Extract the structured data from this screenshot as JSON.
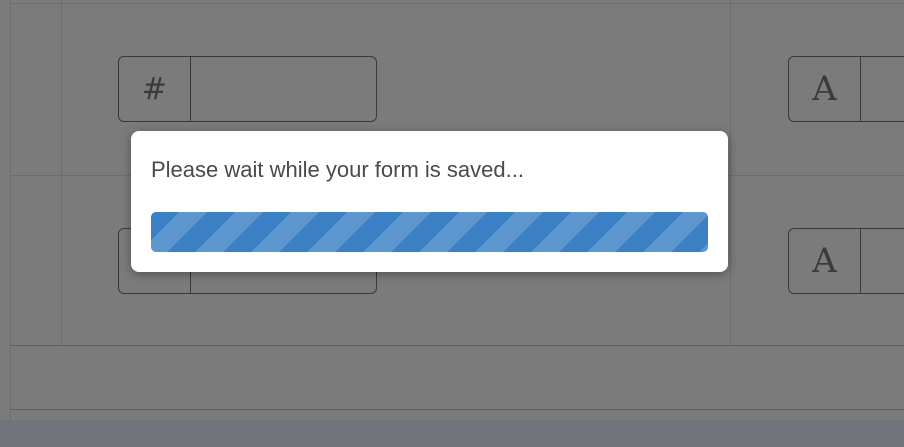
{
  "form": {
    "fields": [
      {
        "prefix": "#",
        "prefix_icon": "hash-icon",
        "value": ""
      },
      {
        "prefix": "A",
        "prefix_icon": "text-type-icon",
        "value": ""
      },
      {
        "prefix": "#",
        "prefix_icon": "hash-icon",
        "value": ""
      },
      {
        "prefix": "A",
        "prefix_icon": "text-type-icon",
        "value": ""
      }
    ]
  },
  "modal": {
    "message": "Please wait while your form is saved...",
    "progress_percent": 100,
    "progress_style": "striped",
    "progress_color": "#3b7fc4"
  },
  "colors": {
    "overlay_background": "#7b7b7b",
    "modal_background": "#ffffff"
  }
}
